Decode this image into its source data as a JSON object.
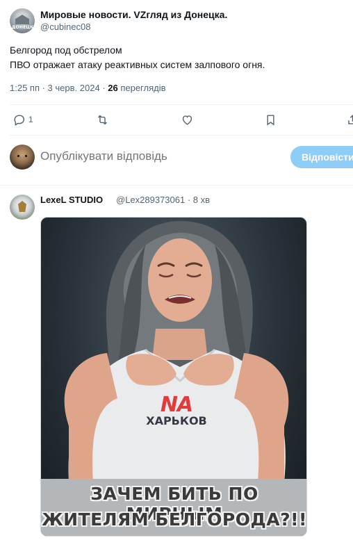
{
  "post": {
    "author_name": "Мировые новости. VZгляд из Донецка.",
    "author_handle": "@cubinec08",
    "avatar_caption": "ДОНЕЦК",
    "lines": [
      "Белгород под обстрелом",
      "ПВО отражает атаку реактивных систем залпового огня."
    ],
    "timestamp": "1:25 пп · 3 черв. 2024 · ",
    "views_count": "26",
    "views_label": " переглядів"
  },
  "actions": {
    "reply": {
      "icon": "reply-icon",
      "count": "1"
    },
    "repost": {
      "icon": "repost-icon"
    },
    "like": {
      "icon": "heart-icon"
    },
    "bookmark": {
      "icon": "bookmark-icon"
    },
    "share": {
      "icon": "share-icon"
    }
  },
  "composer": {
    "placeholder": "Опублікувати відповідь",
    "button_label": "Відповісти"
  },
  "reply_post": {
    "author_name": "LexeL STUDIO",
    "handle_and_time": "@Lex289373061 · 8 хв",
    "image": {
      "shirt_logo_na": "NA",
      "shirt_logo_city": "ХАРЬКОВ",
      "caption_line1": "ЗАЧЕМ БИТЬ ПО МИРНЫМ",
      "caption_line2": "ЖИТЕЛЯМ БЕЛГОРОДА?!!"
    }
  },
  "colors": {
    "text_primary": "#0f1419",
    "text_secondary": "#536471",
    "accent_disabled": "#8ecdf7",
    "divider": "#eff3f4"
  }
}
